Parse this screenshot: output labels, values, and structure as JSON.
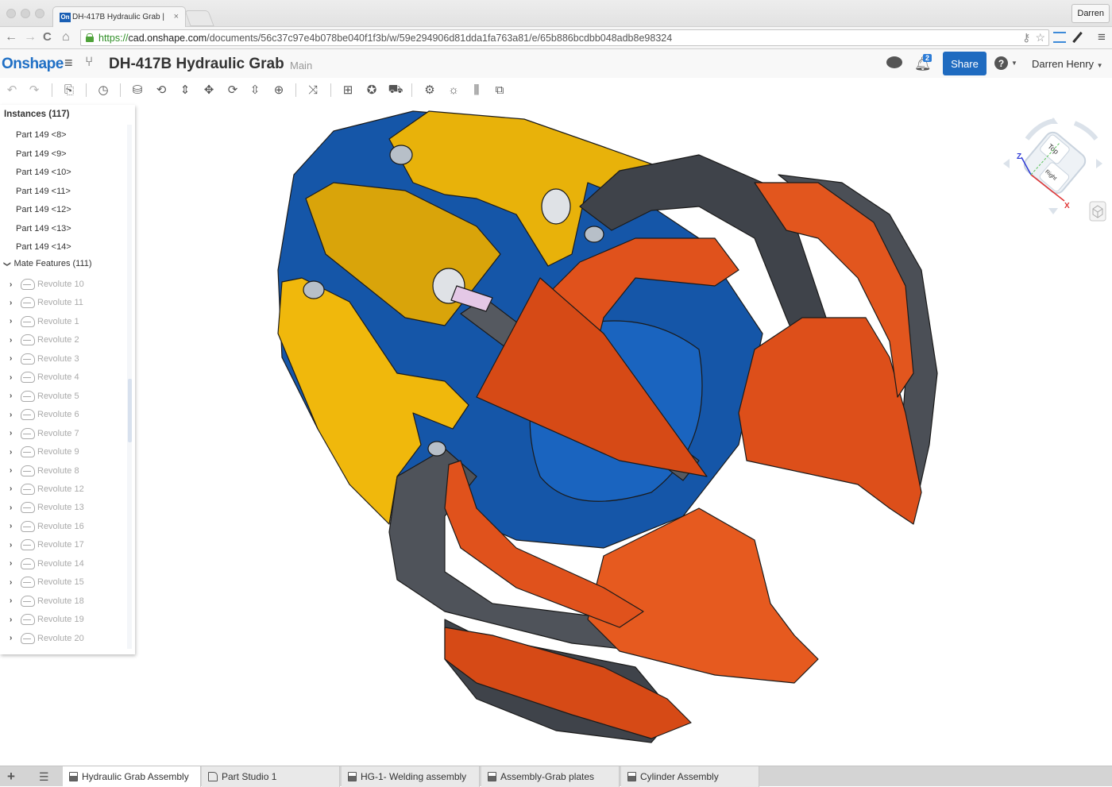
{
  "browser": {
    "tab_title": "DH-417B Hydraulic Grab |",
    "favicon_text": "On",
    "tab_close": "×",
    "profile": "Darren",
    "url_scheme": "https://",
    "url_host": "cad.onshape.com",
    "url_path": "/documents/56c37c97e4b078be040f1f3b/w/59e294906d81dda1fa763a81/e/65b886bcdbb048adb8e98324",
    "icons": {
      "back": "←",
      "forward": "→",
      "reload": "C",
      "home": "⌂",
      "key": "⚷",
      "star": "☆",
      "menu": "≡"
    }
  },
  "app": {
    "logo": "Onshape",
    "menu_icon": "≡",
    "branch_icon": "⑂",
    "document_title": "DH-417B Hydraulic Grab",
    "workspace": "Main",
    "notification_count": "2",
    "share_label": "Share",
    "help_label": "?",
    "user_name": "Darren Henry",
    "brand_color": "#1f6bc0"
  },
  "toolbar": {
    "icons": [
      {
        "name": "undo-icon",
        "glyph": "↶",
        "dim": true
      },
      {
        "name": "redo-icon",
        "glyph": "↷",
        "dim": true
      },
      {
        "name": "insert-icon",
        "glyph": "⎘"
      },
      {
        "name": "history-icon",
        "glyph": "◷"
      },
      {
        "name": "fastened-mate-icon",
        "glyph": "⛁"
      },
      {
        "name": "revolute-mate-icon",
        "glyph": "⟲"
      },
      {
        "name": "slider-mate-icon",
        "glyph": "⇕"
      },
      {
        "name": "planar-mate-icon",
        "glyph": "✥"
      },
      {
        "name": "cylindrical-mate-icon",
        "glyph": "⟳"
      },
      {
        "name": "pin-slot-mate-icon",
        "glyph": "⇳"
      },
      {
        "name": "ball-mate-icon",
        "glyph": "⊕"
      },
      {
        "name": "tangent-mate-icon",
        "glyph": "⤨"
      },
      {
        "name": "group-icon",
        "glyph": "⊞"
      },
      {
        "name": "mate-connector-icon",
        "glyph": "✪"
      },
      {
        "name": "replicate-icon",
        "glyph": "⛟"
      },
      {
        "name": "gear-relation-icon",
        "glyph": "⚙"
      },
      {
        "name": "rack-pinion-icon",
        "glyph": "☼"
      },
      {
        "name": "screw-relation-icon",
        "glyph": "⫼"
      },
      {
        "name": "linear-relation-icon",
        "glyph": "⧉"
      }
    ]
  },
  "sidebar": {
    "instances_header": "Instances (117)",
    "instances": [
      "Part 149 <8>",
      "Part 149 <9>",
      "Part 149 <10>",
      "Part 149 <11>",
      "Part 149 <12>",
      "Part 149 <13>",
      "Part 149 <14>"
    ],
    "mate_group": "Mate Features (111)",
    "mates": [
      "Revolute 10",
      "Revolute 11",
      "Revolute 1",
      "Revolute 2",
      "Revolute 3",
      "Revolute 4",
      "Revolute 5",
      "Revolute 6",
      "Revolute 7",
      "Revolute 9",
      "Revolute 8",
      "Revolute 12",
      "Revolute 13",
      "Revolute 16",
      "Revolute 17",
      "Revolute 14",
      "Revolute 15",
      "Revolute 18",
      "Revolute 19",
      "Revolute 20"
    ]
  },
  "view_cube": {
    "top_face": "Top",
    "right_face": "Right",
    "axis_z": "Z",
    "axis_x": "X"
  },
  "model_colors": {
    "yellow": "#e8b20a",
    "blue": "#1556a8",
    "orange": "#e0521c",
    "gray": "#4a4e55"
  },
  "bottom_tabs": {
    "add_icon": "+",
    "list_icon": "☰",
    "tabs": [
      {
        "label": "Hydraulic Grab Assembly",
        "type": "assembly",
        "active": true
      },
      {
        "label": "Part Studio 1",
        "type": "partstudio",
        "active": false
      },
      {
        "label": "HG-1- Welding assembly",
        "type": "assembly",
        "active": false
      },
      {
        "label": "Assembly-Grab plates",
        "type": "assembly",
        "active": false
      },
      {
        "label": "Cylinder Assembly",
        "type": "assembly",
        "active": false
      }
    ]
  }
}
